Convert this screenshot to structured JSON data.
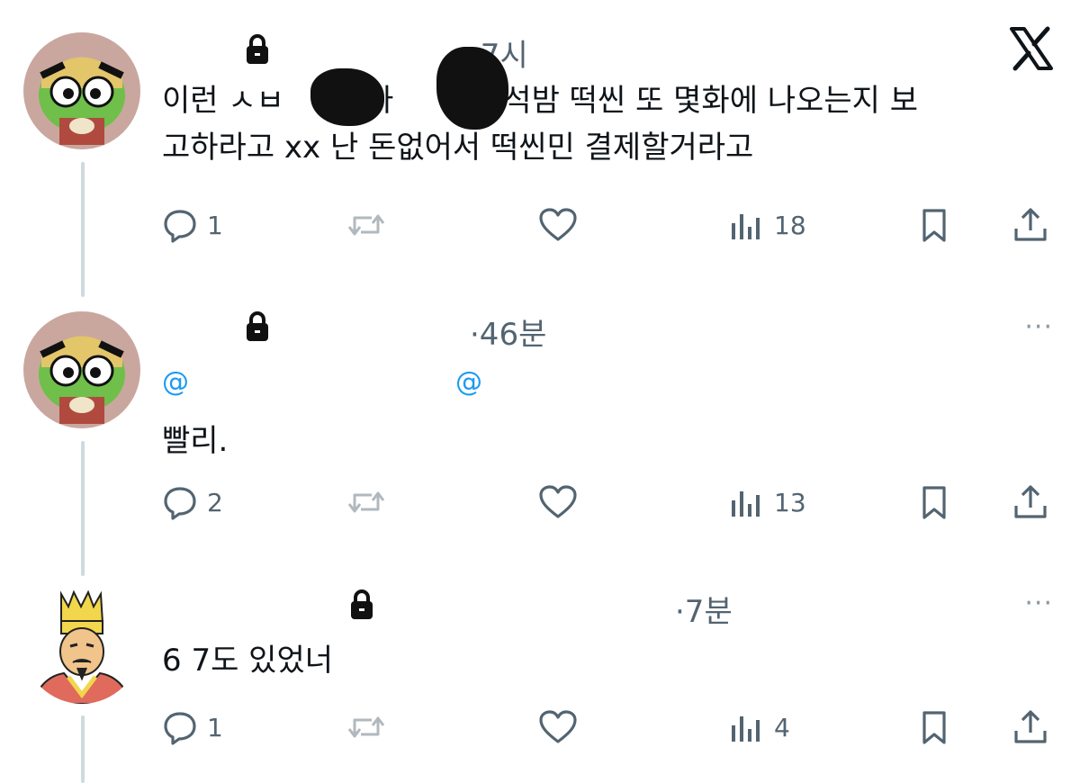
{
  "colors": {
    "text": "#0f1419",
    "muted": "#536471",
    "accent": "#1d9bf0",
    "thread": "#cfd9de"
  },
  "tweets": [
    {
      "time": "·7시",
      "text_line1_a": "이런 ㅅㅂ",
      "text_line1_b": "아",
      "text_line1_c": "아 석밤 떡씬 또 몇화에 나오는지 보",
      "text_line2": "고하라고 xx 난 돈없어서 떡씬민 결제할거라고",
      "reply_count": "1",
      "views": "18",
      "avatar": "frog-avatar"
    },
    {
      "time": "·46분",
      "mention1": "@",
      "mention2": "@",
      "text": "빨리.",
      "reply_count": "2",
      "views": "13",
      "more": "···",
      "avatar": "frog-avatar"
    },
    {
      "time": "·7분",
      "text": "6 7도 있었너",
      "reply_count": "1",
      "views": "4",
      "more": "···",
      "avatar": "king-avatar"
    }
  ],
  "icons": [
    "x-logo-icon",
    "lock-icon",
    "reply-icon",
    "retweet-icon",
    "like-icon",
    "views-icon",
    "bookmark-icon",
    "share-icon",
    "more-icon"
  ]
}
